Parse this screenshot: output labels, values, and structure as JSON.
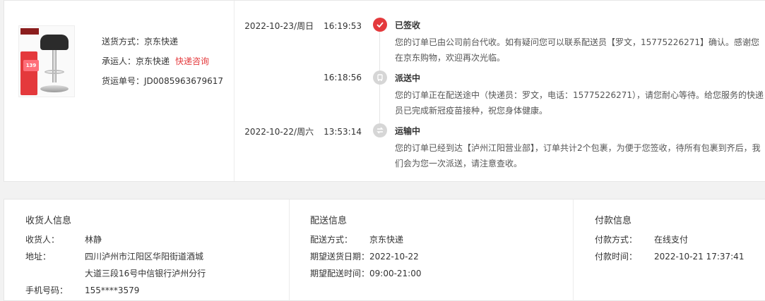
{
  "package": {
    "shipping_method_label": "送货方式：",
    "shipping_method_value": "京东快递",
    "carrier_label": "承运人：",
    "carrier_value": "京东快递",
    "inquiry_link": "快递咨询",
    "waybill_label": "货运单号：",
    "waybill_value": "JD0085963679617"
  },
  "timeline": [
    {
      "date": "2022-10-23/周日",
      "time": "16:19:53",
      "status": "已签收",
      "desc": "您的订单已由公司前台代收。如有疑问您可以联系配送员【罗文，15775226271】确认。感谢您在京东购物，欢迎再次光临。",
      "icon": "check-icon"
    },
    {
      "date": "",
      "time": "16:18:56",
      "status": "派送中",
      "desc": "您的订单正在配送途中（快递员：罗文，电话：15775226271），请您耐心等待。给您服务的快递员已完成新冠疫苗接种，祝您身体健康。",
      "icon": "delivery-icon"
    },
    {
      "date": "2022-10-22/周六",
      "time": "13:53:14",
      "status": "运输中",
      "desc": "您的订单已经到达【泸州江阳营业部】，订单共计2个包裹，为便于您签收，待所有包裹到齐后，我们会为您一次派送，请注意查收。",
      "icon": "transit-icon"
    }
  ],
  "consignee": {
    "title": "收货人信息",
    "name_label": "收货人：",
    "name_value": "林静",
    "address_label": "地址：",
    "address_line1": "四川泸州市江阳区华阳街道酒城",
    "address_line2": "大道三段16号中信银行泸州分行",
    "phone_label": "手机号码：",
    "phone_value": "155****3579"
  },
  "delivery": {
    "title": "配送信息",
    "method_label": "配送方式：",
    "method_value": "京东快递",
    "date_label": "期望送货日期：",
    "date_value": "2022-10-22",
    "time_label": "期望配送时间：",
    "time_value": "09:00-21:00"
  },
  "payment": {
    "title": "付款信息",
    "method_label": "付款方式：",
    "method_value": "在线支付",
    "time_label": "付款时间：",
    "time_value": "2022-10-21 17:37:41"
  },
  "product_image": {
    "price_badge": "139"
  },
  "colors": {
    "accent_red": "#e4393c",
    "icon_gray": "#d6d6d6"
  }
}
